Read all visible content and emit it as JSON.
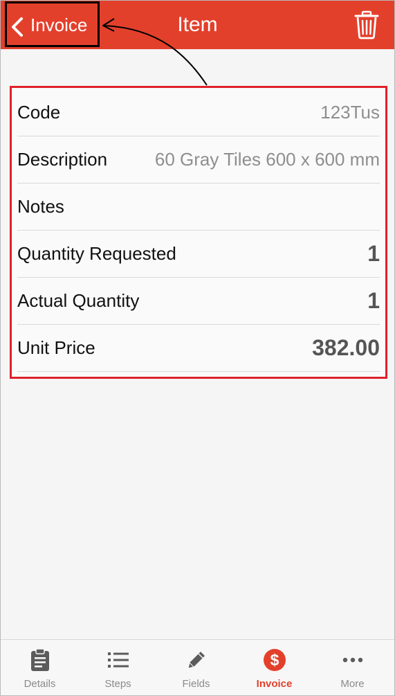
{
  "header": {
    "back_label": "Invoice",
    "title": "Item",
    "accent_color": "#e3402c"
  },
  "item_fields": [
    {
      "label": "Code",
      "value": "123Tus"
    },
    {
      "label": "Description",
      "value": "60 Gray Tiles 600 x 600 mm"
    },
    {
      "label": "Notes",
      "value": ""
    },
    {
      "label": "Quantity Requested",
      "value": "1"
    },
    {
      "label": "Actual Quantity",
      "value": "1"
    },
    {
      "label": "Unit Price",
      "value": "382.00"
    }
  ],
  "tabbar": {
    "tabs": [
      {
        "label": "Details",
        "icon": "clipboard-icon"
      },
      {
        "label": "Steps",
        "icon": "list-icon"
      },
      {
        "label": "Fields",
        "icon": "pencil-icon"
      },
      {
        "label": "Invoice",
        "icon": "dollar-circle-icon"
      },
      {
        "label": "More",
        "icon": "more-dots-icon"
      }
    ],
    "active": "Invoice"
  }
}
